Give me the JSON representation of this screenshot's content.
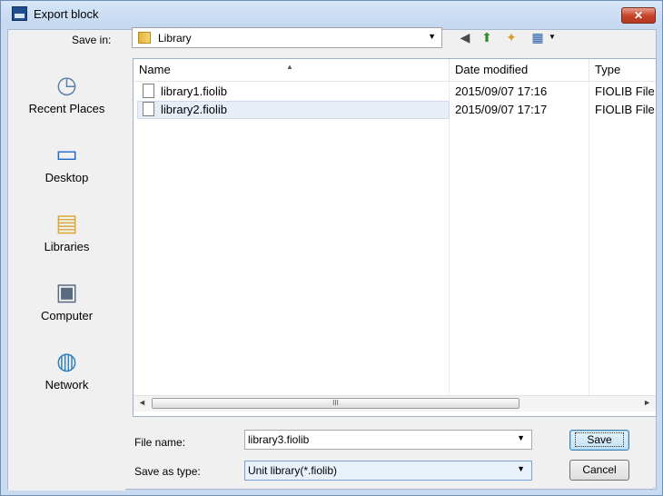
{
  "window": {
    "title": "Export block",
    "close_label": "✕"
  },
  "toolbar": {
    "save_in_label": "Save in:",
    "save_in_value": "Library"
  },
  "places": [
    {
      "label": "Recent Places",
      "icon": "recent-places-icon"
    },
    {
      "label": "Desktop",
      "icon": "desktop-icon"
    },
    {
      "label": "Libraries",
      "icon": "libraries-icon"
    },
    {
      "label": "Computer",
      "icon": "computer-icon"
    },
    {
      "label": "Network",
      "icon": "network-icon"
    }
  ],
  "columns": {
    "name": "Name",
    "date": "Date modified",
    "type": "Type"
  },
  "files": [
    {
      "name": "library1.fiolib",
      "date": "2015/09/07 17:16",
      "type": "FIOLIB File"
    },
    {
      "name": "library2.fiolib",
      "date": "2015/09/07 17:17",
      "type": "FIOLIB File"
    }
  ],
  "scroll": {
    "thumb_grip": "III",
    "left": "◄",
    "right": "►"
  },
  "form": {
    "filename_label": "File name:",
    "filename_value": "library3.fiolib",
    "type_label": "Save as type:",
    "type_value": "Unit library(*.fiolib)"
  },
  "buttons": {
    "save": "Save",
    "cancel": "Cancel"
  },
  "colors": {
    "title_bar": "#c9daf1",
    "close": "#c7452c",
    "selection": "#e8eef8"
  }
}
